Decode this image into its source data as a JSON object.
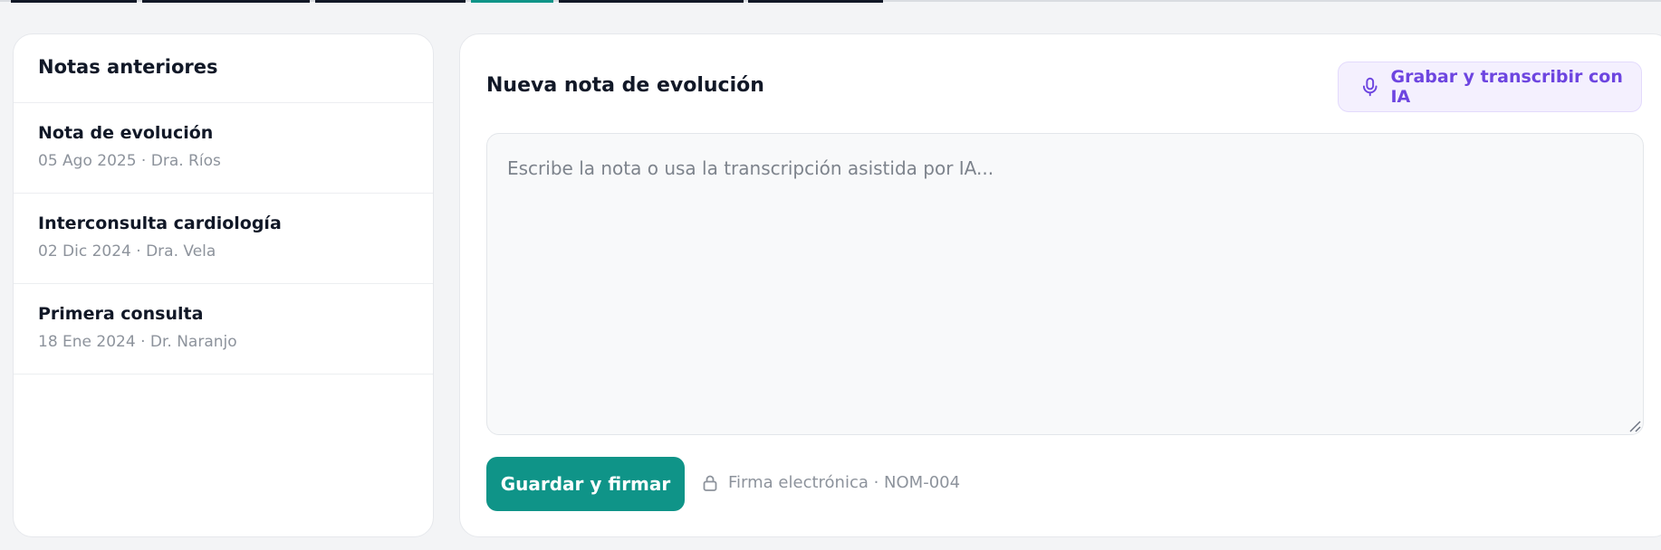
{
  "sidebar": {
    "title": "Notas anteriores",
    "items": [
      {
        "title": "Nota de evolución",
        "meta": "05 Ago 2025 · Dra. Ríos"
      },
      {
        "title": "Interconsulta cardiología",
        "meta": "02 Dic 2024 · Dra. Vela"
      },
      {
        "title": "Primera consulta",
        "meta": "18 Ene 2024 · Dr. Naranjo"
      }
    ]
  },
  "editor": {
    "title": "Nueva nota de evolución",
    "ai_button_label": "Grabar y transcribir con IA",
    "textarea_placeholder": "Escribe la nota o usa la transcripción asistida por IA...",
    "textarea_value": "",
    "save_button_label": "Guardar y firmar",
    "signature_info": "Firma electrónica · NOM-004"
  },
  "icons": {
    "ai_button": "microphone-icon",
    "signature": "lock-icon"
  },
  "colors": {
    "primary": "#0f9488",
    "ai_accent": "#6d45e0",
    "ai_background": "#f4f0fe",
    "muted_text": "#8d939c"
  }
}
